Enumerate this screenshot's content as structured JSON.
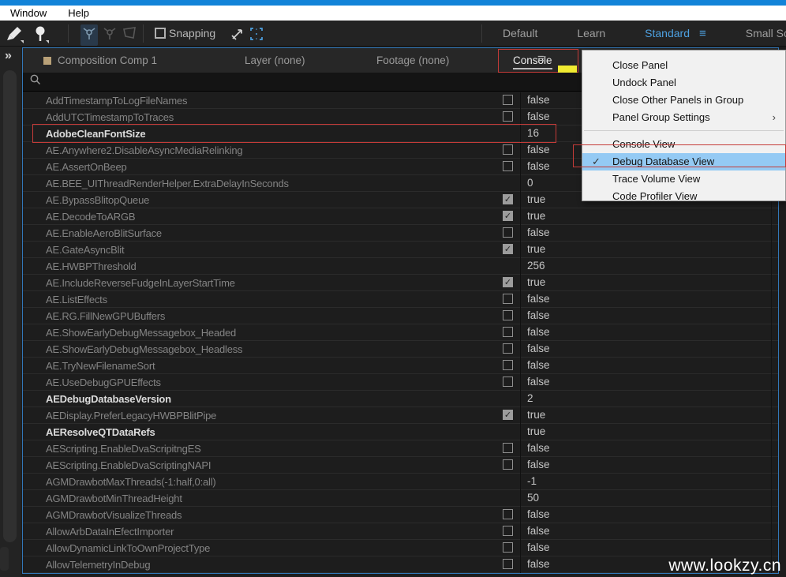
{
  "menubar": {
    "items": [
      "Window",
      "Help"
    ]
  },
  "toolbar": {
    "snapping_label": "Snapping",
    "icons": [
      "brush-tool-icon",
      "pin-tool-icon",
      "orbit-camera-icon",
      "pan-camera-icon",
      "dolly-camera-icon",
      "snap-arrow-icon",
      "region-grid-icon"
    ],
    "workspaces": [
      {
        "label": "Default",
        "active": false,
        "menu": false
      },
      {
        "label": "Learn",
        "active": false,
        "menu": false
      },
      {
        "label": "Standard",
        "active": true,
        "menu": true
      },
      {
        "label": "Small Scr",
        "active": false,
        "menu": false
      }
    ]
  },
  "left_strip": {
    "chevrons": "»"
  },
  "panel": {
    "tabs": [
      {
        "label": "Composition Comp 1",
        "active": false,
        "swatch": true
      },
      {
        "label": "Layer (none)",
        "active": false,
        "swatch": false
      },
      {
        "label": "Footage (none)",
        "active": false,
        "swatch": false
      },
      {
        "label": "Console",
        "active": true,
        "swatch": false
      }
    ],
    "menu_icon": "≡",
    "search": {
      "value": ""
    },
    "rows": [
      {
        "name": "AddTimestampToLogFileNames",
        "checkbox": "unchecked",
        "value": "false",
        "bold": false
      },
      {
        "name": "AddUTCTimestampToTraces",
        "checkbox": "unchecked",
        "value": "false",
        "bold": false
      },
      {
        "name": "AdobeCleanFontSize",
        "checkbox": "none",
        "value": "16",
        "bold": true
      },
      {
        "name": "AE.Anywhere2.DisableAsyncMediaRelinking",
        "checkbox": "unchecked",
        "value": "false",
        "bold": false
      },
      {
        "name": "AE.AssertOnBeep",
        "checkbox": "unchecked",
        "value": "false",
        "bold": false
      },
      {
        "name": "AE.BEE_UIThreadRenderHelper.ExtraDelayInSeconds",
        "checkbox": "none",
        "value": "0",
        "bold": false
      },
      {
        "name": "AE.BypassBlitopQueue",
        "checkbox": "checked",
        "value": "true",
        "bold": false
      },
      {
        "name": "AE.DecodeToARGB",
        "checkbox": "checked",
        "value": "true",
        "bold": false
      },
      {
        "name": "AE.EnableAeroBlitSurface",
        "checkbox": "unchecked",
        "value": "false",
        "bold": false
      },
      {
        "name": "AE.GateAsyncBlit",
        "checkbox": "checked",
        "value": "true",
        "bold": false
      },
      {
        "name": "AE.HWBPThreshold",
        "checkbox": "none",
        "value": "256",
        "bold": false
      },
      {
        "name": "AE.IncludeReverseFudgeInLayerStartTime",
        "checkbox": "checked",
        "value": "true",
        "bold": false
      },
      {
        "name": "AE.ListEffects",
        "checkbox": "unchecked",
        "value": "false",
        "bold": false
      },
      {
        "name": "AE.RG.FillNewGPUBuffers",
        "checkbox": "unchecked",
        "value": "false",
        "bold": false
      },
      {
        "name": "AE.ShowEarlyDebugMessagebox_Headed",
        "checkbox": "unchecked",
        "value": "false",
        "bold": false
      },
      {
        "name": "AE.ShowEarlyDebugMessagebox_Headless",
        "checkbox": "unchecked",
        "value": "false",
        "bold": false
      },
      {
        "name": "AE.TryNewFilenameSort",
        "checkbox": "unchecked",
        "value": "false",
        "bold": false
      },
      {
        "name": "AE.UseDebugGPUEffects",
        "checkbox": "unchecked",
        "value": "false",
        "bold": false
      },
      {
        "name": "AEDebugDatabaseVersion",
        "checkbox": "none",
        "value": "2",
        "bold": true
      },
      {
        "name": "AEDisplay.PreferLegacyHWBPBlitPipe",
        "checkbox": "checked",
        "value": "true",
        "bold": false
      },
      {
        "name": "AEResolveQTDataRefs",
        "checkbox": "none",
        "value": "true",
        "bold": true
      },
      {
        "name": "AEScripting.EnableDvaScripitngES",
        "checkbox": "unchecked",
        "value": "false",
        "bold": false
      },
      {
        "name": "AEScripting.EnableDvaScriptingNAPI",
        "checkbox": "unchecked",
        "value": "false",
        "bold": false
      },
      {
        "name": "AGMDrawbotMaxThreads(-1:half,0:all)",
        "checkbox": "none",
        "value": "-1",
        "bold": false
      },
      {
        "name": "AGMDrawbotMinThreadHeight",
        "checkbox": "none",
        "value": "50",
        "bold": false
      },
      {
        "name": "AGMDrawbotVisualizeThreads",
        "checkbox": "unchecked",
        "value": "false",
        "bold": false
      },
      {
        "name": "AllowArbDataInEfectImporter",
        "checkbox": "unchecked",
        "value": "false",
        "bold": false
      },
      {
        "name": "AllowDynamicLinkToOwnProjectType",
        "checkbox": "unchecked",
        "value": "false",
        "bold": false
      },
      {
        "name": "AllowTelemetryInDebug",
        "checkbox": "unchecked",
        "value": "false",
        "bold": false
      }
    ]
  },
  "context_menu": {
    "items": [
      {
        "label": "Close Panel"
      },
      {
        "label": "Undock Panel"
      },
      {
        "label": "Close Other Panels in Group"
      },
      {
        "label": "Panel Group Settings",
        "submenu": true
      },
      {
        "separator": true
      },
      {
        "label": "Console View"
      },
      {
        "label": "Debug Database View",
        "checked": true,
        "highlighted": true
      },
      {
        "label": "Trace Volume View"
      },
      {
        "label": "Code Profiler View"
      }
    ]
  },
  "watermark": "www.lookzy.cn",
  "colors": {
    "titlebar_blue": "#1283d8",
    "panel_border_blue": "#3277b8",
    "workspace_active_blue": "#4da0e0",
    "menu_highlight_blue": "#94caf4",
    "annotation_red": "#c53b38",
    "annotation_yellow": "#f0ea31",
    "composition_swatch": "#b9a178"
  }
}
